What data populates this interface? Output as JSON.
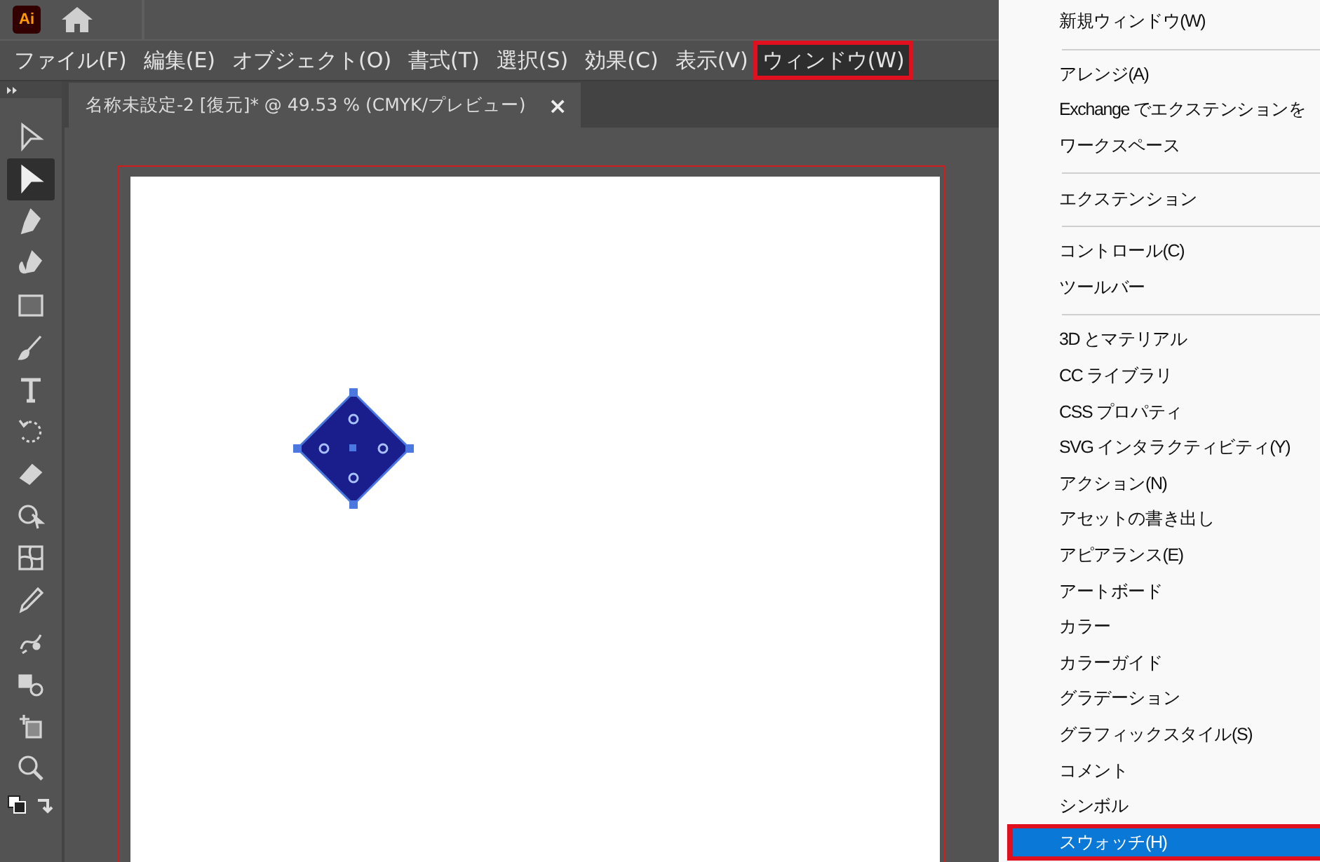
{
  "app": {
    "logo": "Ai"
  },
  "menubar": [
    {
      "label": "ファイル(F)",
      "selected": false,
      "annotated": false
    },
    {
      "label": "編集(E)",
      "selected": false,
      "annotated": false
    },
    {
      "label": "オブジェクト(O)",
      "selected": false,
      "annotated": false
    },
    {
      "label": "書式(T)",
      "selected": false,
      "annotated": false
    },
    {
      "label": "選択(S)",
      "selected": false,
      "annotated": false
    },
    {
      "label": "効果(C)",
      "selected": false,
      "annotated": false
    },
    {
      "label": "表示(V)",
      "selected": false,
      "annotated": false
    },
    {
      "label": "ウィンドウ(W)",
      "selected": true,
      "annotated": true
    }
  ],
  "document_tab": {
    "title": "名称未設定-2 [復元]* @ 49.53 % (CMYK/プレビュー)",
    "close": "×"
  },
  "tools": [
    {
      "kind": "selection",
      "selected": false
    },
    {
      "kind": "direct",
      "selected": true
    },
    {
      "kind": "pen",
      "selected": false
    },
    {
      "kind": "curvature",
      "selected": false
    },
    {
      "kind": "rectangle",
      "selected": false
    },
    {
      "kind": "brush",
      "selected": false
    },
    {
      "kind": "type",
      "selected": false
    },
    {
      "kind": "rotate",
      "selected": false
    },
    {
      "kind": "eraser",
      "selected": false
    },
    {
      "kind": "puppet",
      "selected": false
    },
    {
      "kind": "mesh",
      "selected": false
    },
    {
      "kind": "eyedropper",
      "selected": false
    },
    {
      "kind": "blend",
      "selected": false
    },
    {
      "kind": "shapes",
      "selected": false
    },
    {
      "kind": "artboard",
      "selected": false
    },
    {
      "kind": "zoom",
      "selected": false
    }
  ],
  "window_menu": [
    {
      "kind": "item",
      "label": "新規ウィンドウ(W)",
      "selected": false,
      "annotated": false
    },
    {
      "kind": "separator"
    },
    {
      "kind": "item",
      "label": "アレンジ(A)",
      "selected": false,
      "annotated": false
    },
    {
      "kind": "item",
      "label": "Exchange でエクステンションを",
      "selected": false,
      "annotated": false
    },
    {
      "kind": "item",
      "label": "ワークスペース",
      "selected": false,
      "annotated": false
    },
    {
      "kind": "separator"
    },
    {
      "kind": "item",
      "label": "エクステンション",
      "selected": false,
      "annotated": false
    },
    {
      "kind": "separator"
    },
    {
      "kind": "item",
      "label": "コントロール(C)",
      "selected": false,
      "annotated": false
    },
    {
      "kind": "item",
      "label": "ツールバー",
      "selected": false,
      "annotated": false
    },
    {
      "kind": "separator"
    },
    {
      "kind": "item",
      "label": "3D とマテリアル",
      "selected": false,
      "annotated": false
    },
    {
      "kind": "item",
      "label": "CC ライブラリ",
      "selected": false,
      "annotated": false
    },
    {
      "kind": "item",
      "label": "CSS プロパティ",
      "selected": false,
      "annotated": false
    },
    {
      "kind": "item",
      "label": "SVG インタラクティビティ(Y)",
      "selected": false,
      "annotated": false
    },
    {
      "kind": "item",
      "label": "アクション(N)",
      "selected": false,
      "annotated": false
    },
    {
      "kind": "item",
      "label": "アセットの書き出し",
      "selected": false,
      "annotated": false
    },
    {
      "kind": "item",
      "label": "アピアランス(E)",
      "selected": false,
      "annotated": false
    },
    {
      "kind": "item",
      "label": "アートボード",
      "selected": false,
      "annotated": false
    },
    {
      "kind": "item",
      "label": "カラー",
      "selected": false,
      "annotated": false
    },
    {
      "kind": "item",
      "label": "カラーガイド",
      "selected": false,
      "annotated": false
    },
    {
      "kind": "item",
      "label": "グラデーション",
      "selected": false,
      "annotated": false
    },
    {
      "kind": "item",
      "label": "グラフィックスタイル(S)",
      "selected": false,
      "annotated": false
    },
    {
      "kind": "item",
      "label": "コメント",
      "selected": false,
      "annotated": false
    },
    {
      "kind": "item",
      "label": "シンボル",
      "selected": false,
      "annotated": false
    },
    {
      "kind": "item",
      "label": "スウォッチ(H)",
      "selected": true,
      "annotated": true
    }
  ]
}
